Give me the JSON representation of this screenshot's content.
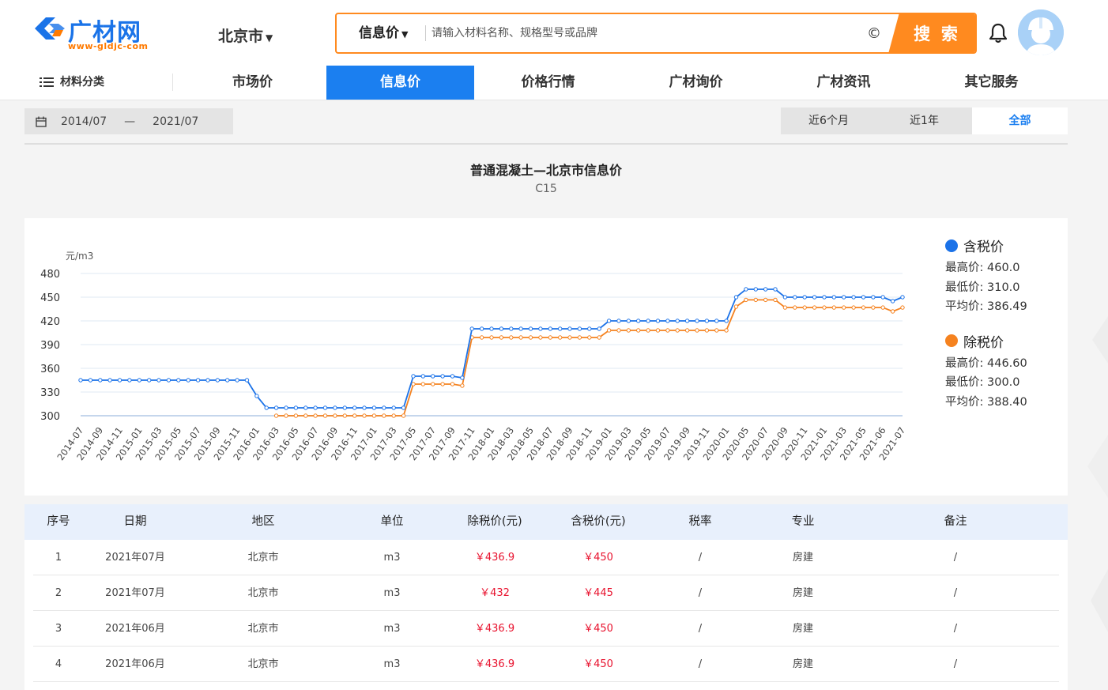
{
  "header": {
    "logo_text": "广材网",
    "logo_url": "www-gldjc-com",
    "city": "北京市",
    "search_type": "信息价",
    "search_placeholder": "请输入材料名称、规格型号或品牌",
    "clear_symbol": "©",
    "search_button": "搜 索"
  },
  "nav": {
    "category": "材料分类",
    "items": [
      {
        "label": "市场价",
        "active": false
      },
      {
        "label": "信息价",
        "active": true
      },
      {
        "label": "价格行情",
        "active": false
      },
      {
        "label": "广材询价",
        "active": false
      },
      {
        "label": "广材资讯",
        "active": false
      },
      {
        "label": "其它服务",
        "active": false
      }
    ]
  },
  "filter": {
    "start": "2014/07",
    "dash": "—",
    "end": "2021/07",
    "periods": [
      {
        "label": "近6个月",
        "active": false
      },
      {
        "label": "近1年",
        "active": false
      },
      {
        "label": "全部",
        "active": true
      }
    ]
  },
  "chart_title": "普通混凝土—北京市信息价",
  "chart_subtitle": "C15",
  "chart_data": {
    "type": "line",
    "ylabel": "元/m3",
    "ylim": [
      300,
      480
    ],
    "yticks": [
      480,
      450,
      420,
      390,
      360,
      330,
      300
    ],
    "grid": true,
    "legend_position": "right",
    "tick_labels": [
      "2014-07",
      "2014-09",
      "2014-11",
      "2015-01",
      "2015-03",
      "2015-05",
      "2015-07",
      "2015-09",
      "2015-11",
      "2016-01",
      "2016-03",
      "2016-05",
      "2016-07",
      "2016-09",
      "2016-11",
      "2017-01",
      "2017-03",
      "2017-05",
      "2017-07",
      "2017-09",
      "2017-11",
      "2018-01",
      "2018-03",
      "2018-05",
      "2018-07",
      "2018-09",
      "2018-11",
      "2019-01",
      "2019-03",
      "2019-05",
      "2019-07",
      "2019-09",
      "2019-11",
      "2020-01",
      "2020-05",
      "2020-07",
      "2020-09",
      "2020-11",
      "2021-01",
      "2021-03",
      "2021-05",
      "2021-06",
      "2021-07"
    ],
    "x": [
      "2014-07",
      "2014-08",
      "2014-09",
      "2014-10",
      "2014-11",
      "2014-12",
      "2015-01",
      "2015-02",
      "2015-03",
      "2015-04",
      "2015-05",
      "2015-06",
      "2015-07",
      "2015-08",
      "2015-09",
      "2015-10",
      "2015-11",
      "2015-12",
      "2016-01",
      "2016-02",
      "2016-03",
      "2016-04",
      "2016-05",
      "2016-06",
      "2016-07",
      "2016-08",
      "2016-09",
      "2016-10",
      "2016-11",
      "2016-12",
      "2017-01",
      "2017-02",
      "2017-03",
      "2017-04",
      "2017-05",
      "2017-06",
      "2017-07",
      "2017-08",
      "2017-09",
      "2017-10",
      "2017-11",
      "2017-12",
      "2018-01",
      "2018-02",
      "2018-03",
      "2018-04",
      "2018-05",
      "2018-06",
      "2018-07",
      "2018-08",
      "2018-09",
      "2018-10",
      "2018-11",
      "2018-12",
      "2019-01",
      "2019-02",
      "2019-03",
      "2019-04",
      "2019-05",
      "2019-06",
      "2019-07",
      "2019-08",
      "2019-09",
      "2019-10",
      "2019-11",
      "2019-12",
      "2020-01",
      "2020-02",
      "2020-05",
      "2020-06",
      "2020-07",
      "2020-08",
      "2020-09",
      "2020-10",
      "2020-11",
      "2020-12",
      "2021-01",
      "2021-02",
      "2021-03",
      "2021-04",
      "2021-05",
      "2021-06a",
      "2021-06",
      "2021-07a",
      "2021-07"
    ],
    "series": [
      {
        "name": "含税价",
        "color": "#1b72e8",
        "max_label": "最高价: 460.0",
        "min_label": "最低价: 310.0",
        "avg_label": "平均价: 386.49",
        "values": [
          345,
          345,
          345,
          345,
          345,
          345,
          345,
          345,
          345,
          345,
          345,
          345,
          345,
          345,
          345,
          345,
          345,
          345,
          325,
          310,
          310,
          310,
          310,
          310,
          310,
          310,
          310,
          310,
          310,
          310,
          310,
          310,
          310,
          310,
          350,
          350,
          350,
          350,
          350,
          348,
          410,
          410,
          410,
          410,
          410,
          410,
          410,
          410,
          410,
          410,
          410,
          410,
          410,
          410,
          420,
          420,
          420,
          420,
          420,
          420,
          420,
          420,
          420,
          420,
          420,
          420,
          420,
          450,
          460,
          460,
          460,
          460,
          450,
          450,
          450,
          450,
          450,
          450,
          450,
          450,
          450,
          450,
          450,
          445,
          450
        ]
      },
      {
        "name": "除税价",
        "color": "#f5821f",
        "max_label": "最高价: 446.60",
        "min_label": "最低价: 300.0",
        "avg_label": "平均价: 388.40",
        "values": [
          null,
          null,
          null,
          null,
          null,
          null,
          null,
          null,
          null,
          null,
          null,
          null,
          null,
          null,
          null,
          null,
          null,
          null,
          null,
          null,
          300,
          300,
          300,
          300,
          300,
          300,
          300,
          300,
          300,
          300,
          300,
          300,
          300,
          300,
          340,
          340,
          340,
          340,
          340,
          338,
          399,
          399,
          399,
          399,
          399,
          399,
          399,
          399,
          399,
          399,
          399,
          399,
          399,
          399,
          408,
          408,
          408,
          408,
          408,
          408,
          408,
          408,
          408,
          408,
          408,
          408,
          408,
          438,
          446.6,
          446.6,
          446.6,
          446.6,
          436.9,
          436.9,
          436.9,
          436.9,
          436.9,
          436.9,
          436.9,
          436.9,
          436.9,
          436.9,
          436.9,
          432,
          436.9
        ]
      }
    ]
  },
  "table": {
    "headers": [
      "序号",
      "日期",
      "地区",
      "单位",
      "除税价(元)",
      "含税价(元)",
      "税率",
      "专业",
      "备注"
    ],
    "rows": [
      [
        "1",
        "2021年07月",
        "北京市",
        "m3",
        "￥436.9",
        "￥450",
        "/",
        "房建",
        "/"
      ],
      [
        "2",
        "2021年07月",
        "北京市",
        "m3",
        "￥432",
        "￥445",
        "/",
        "房建",
        "/"
      ],
      [
        "3",
        "2021年06月",
        "北京市",
        "m3",
        "￥436.9",
        "￥450",
        "/",
        "房建",
        "/"
      ],
      [
        "4",
        "2021年06月",
        "北京市",
        "m3",
        "￥436.9",
        "￥450",
        "/",
        "房建",
        "/"
      ]
    ]
  }
}
